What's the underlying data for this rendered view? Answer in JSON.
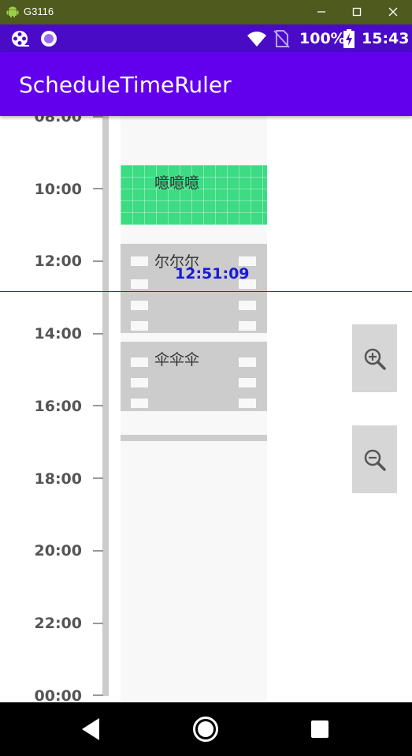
{
  "window": {
    "title": "G3116"
  },
  "status_bar": {
    "battery": "100%",
    "time": "15:43"
  },
  "app_bar": {
    "title": "ScheduleTimeRuler"
  },
  "ruler": {
    "ticks": [
      "08:00",
      "10:00",
      "12:00",
      "14:00",
      "16:00",
      "18:00",
      "20:00",
      "22:00",
      "00:00"
    ]
  },
  "events": [
    {
      "label": "噫噫噫",
      "style": "grid",
      "color": "#3ddc84"
    },
    {
      "label": "尔尔尔",
      "style": "film",
      "color": "#cccccc"
    },
    {
      "label": "伞伞伞",
      "style": "film",
      "color": "#cccccc"
    }
  ],
  "current_time": {
    "label": "12:51:09",
    "color": "#1a1ad8"
  },
  "zoom": {
    "in_icon": "zoom-in-icon",
    "out_icon": "zoom-out-icon"
  },
  "colors": {
    "status_bar": "#4a0bc7",
    "app_bar": "#6200ee",
    "window_titlebar": "#4f5b1e"
  }
}
